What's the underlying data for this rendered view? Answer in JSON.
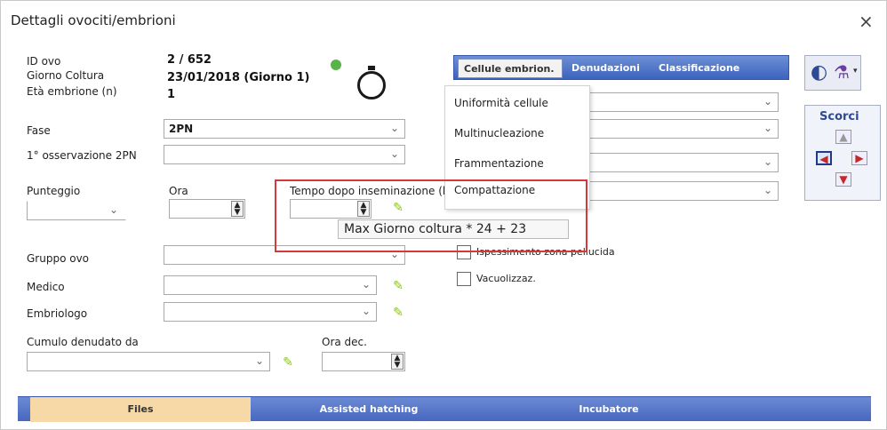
{
  "window": {
    "title": "Dettagli ovociti/embrioni",
    "close_symbol": "×"
  },
  "info": {
    "id_ovo_label": "ID ovo",
    "id_ovo_value": "2 / 652",
    "giorno_coltura_label": "Giorno Coltura",
    "giorno_coltura_value": "23/01/2018 (Giorno 1)",
    "eta_embrione_label": "Età embrione (n)",
    "eta_embrione_value": "1"
  },
  "form": {
    "fase_label": "Fase",
    "fase_value": "2PN",
    "osservazione_label": "1° osservazione 2PN",
    "punteggio_label": "Punteggio",
    "ora_label": "Ora",
    "tempo_label": "Tempo dopo inseminazione (h)",
    "gruppo_label": "Gruppo ovo",
    "medico_label": "Medico",
    "embriologo_label": "Embriologo",
    "cumulo_label": "Cumulo denudato da",
    "ora_dec_label": "Ora dec."
  },
  "tabs": [
    {
      "label": "Cellule embrion.",
      "active": true
    },
    {
      "label": "Denudazioni",
      "active": false
    },
    {
      "label": "Classificazione",
      "active": false
    }
  ],
  "menu_items": [
    "Uniformità cellule",
    "Multinucleazione",
    "Frammentazione",
    "Compattazione"
  ],
  "checkboxes": [
    {
      "label": "Ispessimento zona pellucida"
    },
    {
      "label": "Vacuolizzaz."
    }
  ],
  "tooltip": {
    "text": "Max Giorno coltura * 24 + 23"
  },
  "scorci": {
    "title": "Scorci"
  },
  "bottom_tabs": [
    {
      "label": "Files",
      "active": true
    },
    {
      "label": "Assisted hatching",
      "active": false
    },
    {
      "label": "Incubatore",
      "active": false
    }
  ],
  "colors": {
    "accent_blue": "#3c63be",
    "highlight_red": "#d43a3a",
    "active_bottom_tab": "#f6d9a6",
    "pen_green": "#8cc21b"
  }
}
